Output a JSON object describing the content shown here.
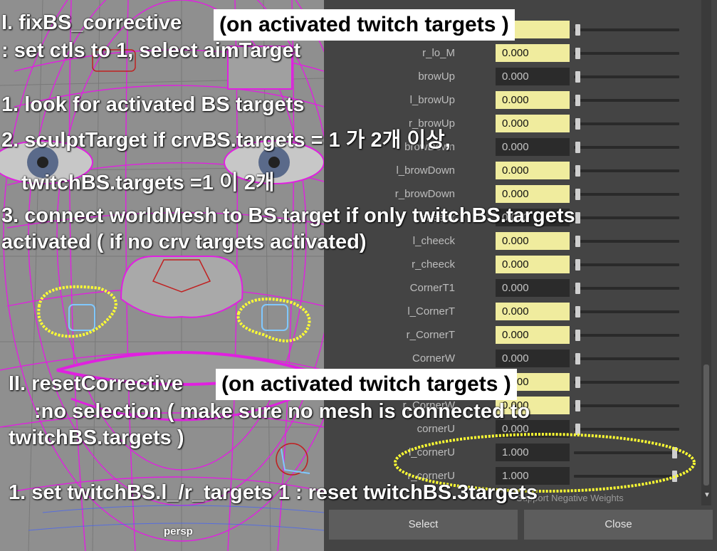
{
  "viewport": {
    "camera_label": "persp"
  },
  "annotations": {
    "title_1": "I. fixBS_corrective",
    "box_1": "(on activated twitch targets )",
    "sub_1": ": set ctls to 1, select aimTarget",
    "step_1_1": "1. look for activated BS targets",
    "step_1_2": "2. sculptTarget if crvBS.targets = 1 가 2개 이상,",
    "step_1_2b": "twitchBS.targets =1 이 2개",
    "step_1_3": "3. connect worldMesh to BS.target if only twitchBS.targets",
    "step_1_3b": "activated ( if no crv targets activated)",
    "title_2": "II. resetCorrective",
    "box_2": "(on activated twitch targets )",
    "sub_2": ":no selection ( make sure no mesh is connected to",
    "sub_2b": "twitchBS.targets )",
    "step_2_1": "1. set twitchBS.l_/r_targets 1 : reset twitchBS.3targets"
  },
  "panel": {
    "rows": [
      {
        "label": "",
        "value": "",
        "style": "yellow",
        "knob": "left"
      },
      {
        "label": "r_lo_M",
        "value": "0.000",
        "style": "yellow",
        "knob": "left"
      },
      {
        "label": "browUp",
        "value": "0.000",
        "style": "dark",
        "knob": "left"
      },
      {
        "label": "l_browUp",
        "value": "0.000",
        "style": "yellow",
        "knob": "left"
      },
      {
        "label": "r_browUp",
        "value": "0.000",
        "style": "yellow",
        "knob": "left"
      },
      {
        "label": "browDown",
        "value": "0.000",
        "style": "dark",
        "knob": "left"
      },
      {
        "label": "l_browDown",
        "value": "0.000",
        "style": "yellow",
        "knob": "left"
      },
      {
        "label": "r_browDown",
        "value": "0.000",
        "style": "yellow",
        "knob": "left"
      },
      {
        "label": "cheeck",
        "value": "0.000",
        "style": "dark",
        "knob": "left"
      },
      {
        "label": "l_cheeck",
        "value": "0.000",
        "style": "yellow",
        "knob": "left"
      },
      {
        "label": "r_cheeck",
        "value": "0.000",
        "style": "yellow",
        "knob": "left"
      },
      {
        "label": "CornerT1",
        "value": "0.000",
        "style": "dark",
        "knob": "left"
      },
      {
        "label": "l_CornerT",
        "value": "0.000",
        "style": "yellow",
        "knob": "left"
      },
      {
        "label": "r_CornerT",
        "value": "0.000",
        "style": "yellow",
        "knob": "left"
      },
      {
        "label": "CornerW",
        "value": "0.000",
        "style": "dark",
        "knob": "left"
      },
      {
        "label": "l_CornerW",
        "value": "0.000",
        "style": "yellow",
        "knob": "left"
      },
      {
        "label": "r_CornerW",
        "value": "0.000",
        "style": "yellow",
        "knob": "left"
      },
      {
        "label": "cornerU",
        "value": "0.000",
        "style": "dark",
        "knob": "left"
      },
      {
        "label": "l_cornerU",
        "value": "1.000",
        "style": "dark",
        "knob": "right"
      },
      {
        "label": "r_cornerU",
        "value": "1.000",
        "style": "dark",
        "knob": "right"
      }
    ],
    "negative_weights_label": "Support Negative Weights",
    "select_button": "Select",
    "close_button": "Close"
  },
  "colors": {
    "wireframe": "#e020e0",
    "mesh": "#8e8e8e",
    "eye_iris": "#5a6a8a",
    "highlight_yellow": "#f0ec9e",
    "scribble": "#ffff33"
  }
}
